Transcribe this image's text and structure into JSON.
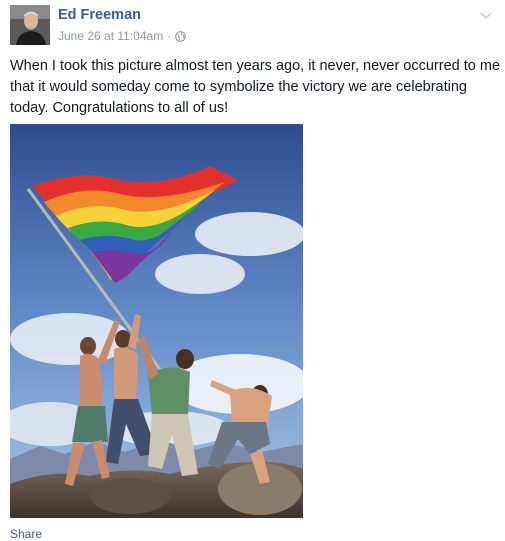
{
  "post": {
    "author": "Ed Freeman",
    "timestamp": "June 26 at 11:04am",
    "separator": "·",
    "privacy_icon": "globe-icon",
    "menu_icon": "chevron-down-icon",
    "message": "When I took this picture almost ten years ago, it never, never occurred to me that it would someday come to symbolize the victory we are celebrating today. Congratulations to all of us!",
    "photo_alt": "Four men raising a rainbow flag on a rocky hilltop",
    "share_label": "Share"
  },
  "colors": {
    "link": "#3b5998",
    "meta": "#9197a3",
    "text": "#141823"
  }
}
